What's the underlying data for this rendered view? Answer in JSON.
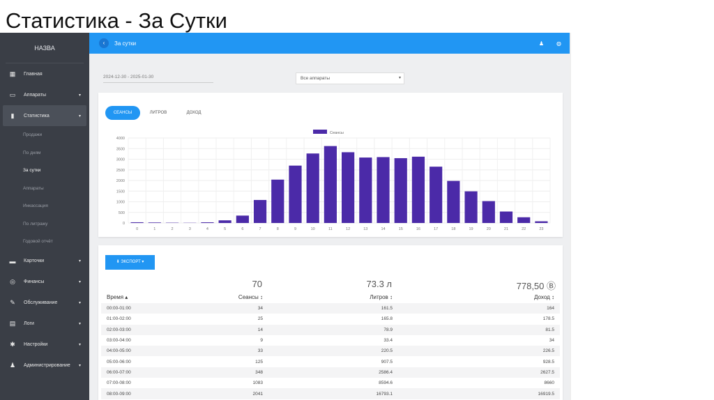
{
  "slide_title": "Статистика - За Сутки",
  "sidebar": {
    "brand": "НАЗВА",
    "items": [
      {
        "label": "Главная",
        "icon": "dashboard-icon",
        "glyph": "▦"
      },
      {
        "label": "Аппараты",
        "icon": "devices-icon",
        "glyph": "▭"
      },
      {
        "label": "Статистика",
        "icon": "bar-chart-icon",
        "glyph": "▮"
      }
    ],
    "sub": [
      "Продажи",
      "По дням",
      "За сутки",
      "Аппараты",
      "Инкассация",
      "По литражу",
      "Годовой отчёт"
    ],
    "items2": [
      {
        "label": "Карточки",
        "icon": "card-icon",
        "glyph": "▬"
      },
      {
        "label": "Финансы",
        "icon": "finance-icon",
        "glyph": "◎"
      },
      {
        "label": "Обслуживание",
        "icon": "wrench-icon",
        "glyph": "✎"
      },
      {
        "label": "Логи",
        "icon": "clipboard-icon",
        "glyph": "▤"
      },
      {
        "label": "Настройки",
        "icon": "gear-icon",
        "glyph": "✱"
      },
      {
        "label": "Администрирование",
        "icon": "user-icon",
        "glyph": "♟"
      }
    ]
  },
  "topbar": {
    "title": "За сутки"
  },
  "filters": {
    "date_range": "2024-12-30 - 2025-01-30",
    "device_select": "Все аппараты"
  },
  "tabs": [
    "СЕАНСЫ",
    "ЛИТРОВ",
    "ДОХОД"
  ],
  "export_label": "ЭКСПОРТ ▾",
  "totals": {
    "sessions": "70",
    "liters": "73.3 л",
    "income": "778,50 Ⓑ"
  },
  "table": {
    "headers": [
      "Время ▴",
      "Сеансы ↕",
      "Литров ↕",
      "Доход ↕"
    ],
    "rows": [
      [
        "00:00-01:00",
        "34",
        "161.5",
        "164"
      ],
      [
        "01:00-02:00",
        "25",
        "165.8",
        "178.5"
      ],
      [
        "02:00-03:00",
        "14",
        "78.9",
        "81.5"
      ],
      [
        "03:00-04:00",
        "9",
        "33.4",
        "34"
      ],
      [
        "04:00-05:00",
        "33",
        "220.5",
        "226.5"
      ],
      [
        "05:00-06:00",
        "125",
        "907.5",
        "928.5"
      ],
      [
        "06:00-07:00",
        "348",
        "2586.4",
        "2627.5"
      ],
      [
        "07:00-08:00",
        "1083",
        "8594.6",
        "8660"
      ],
      [
        "08:00-09:00",
        "2041",
        "16793.1",
        "16919.5"
      ]
    ]
  },
  "chart_data": {
    "type": "bar",
    "legend": "Сеансы",
    "legend_position": "top",
    "categories": [
      "0",
      "1",
      "2",
      "3",
      "4",
      "5",
      "6",
      "7",
      "8",
      "9",
      "10",
      "11",
      "12",
      "13",
      "14",
      "15",
      "16",
      "17",
      "18",
      "19",
      "20",
      "21",
      "22",
      "23"
    ],
    "values": [
      34,
      25,
      14,
      9,
      33,
      125,
      348,
      1083,
      2041,
      2700,
      3270,
      3620,
      3330,
      3080,
      3100,
      3050,
      3120,
      2650,
      1980,
      1490,
      1030,
      540,
      270,
      80
    ],
    "ylim": [
      0,
      4000
    ],
    "yticks": [
      0,
      500,
      1000,
      1500,
      2000,
      2500,
      3000,
      3500,
      4000
    ],
    "color": "#4b2aa8",
    "grid": true
  }
}
